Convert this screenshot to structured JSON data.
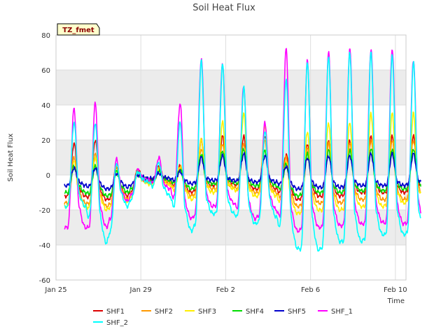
{
  "chart_data": {
    "type": "line",
    "title": "Soil Heat Flux",
    "xlabel": "Time",
    "ylabel": "Soil Heat Flux",
    "tag": "TZ_fmet",
    "xlim": [
      0,
      16.5
    ],
    "ylim": [
      -60,
      80
    ],
    "yticks": [
      -60,
      -40,
      -20,
      0,
      20,
      40,
      60,
      80
    ],
    "xticks": [
      {
        "value": 0,
        "label": "Jan 25"
      },
      {
        "value": 4,
        "label": "Jan 29"
      },
      {
        "value": 8,
        "label": "Feb 2"
      },
      {
        "value": 12,
        "label": "Feb 6"
      },
      {
        "value": 16,
        "label": "Feb 10"
      }
    ],
    "x_range": [
      0.4,
      17.2
    ],
    "band_color": "#ececec",
    "legend_position": "bottom",
    "series": [
      {
        "name": "SHF1",
        "color": "#dd0000",
        "peaks": [
          18,
          20,
          5,
          3,
          5,
          5,
          20,
          22,
          22,
          22,
          12,
          18,
          20,
          20,
          22,
          22,
          22,
          22,
          24
        ],
        "troughs": [
          -12,
          -14,
          -12,
          -3,
          -4,
          -10,
          -6,
          -5,
          -8,
          -8,
          -14,
          -12,
          -12,
          -10,
          -10,
          -10,
          -8,
          -8,
          -8
        ]
      },
      {
        "name": "SHF2",
        "color": "#ff9900",
        "peaks": [
          10,
          12,
          4,
          2,
          4,
          5,
          15,
          18,
          18,
          20,
          10,
          15,
          18,
          18,
          20,
          20,
          20,
          18,
          20
        ],
        "troughs": [
          -16,
          -18,
          -14,
          -4,
          -5,
          -12,
          -8,
          -7,
          -10,
          -10,
          -18,
          -16,
          -16,
          -14,
          -14,
          -14,
          -12,
          -10,
          -10
        ]
      },
      {
        "name": "SHF3",
        "color": "#ffee00",
        "peaks": [
          8,
          10,
          3,
          2,
          3,
          4,
          20,
          30,
          35,
          28,
          8,
          25,
          30,
          30,
          35,
          35,
          35,
          30,
          30
        ],
        "troughs": [
          -18,
          -20,
          -15,
          -5,
          -6,
          -14,
          -10,
          -8,
          -12,
          -12,
          -22,
          -20,
          -20,
          -18,
          -18,
          -16,
          -14,
          -12,
          -12
        ]
      },
      {
        "name": "SHF4",
        "color": "#00dd00",
        "peaks": [
          5,
          5,
          2,
          1,
          2,
          3,
          12,
          14,
          15,
          14,
          6,
          12,
          14,
          14,
          15,
          15,
          15,
          14,
          15
        ],
        "troughs": [
          -10,
          -12,
          -10,
          -3,
          -3,
          -8,
          -5,
          -4,
          -6,
          -6,
          -12,
          -10,
          -10,
          -9,
          -9,
          -8,
          -7,
          -6,
          -6
        ]
      },
      {
        "name": "SHF5",
        "color": "#0000cc",
        "peaks": [
          4,
          4,
          1,
          0,
          1,
          2,
          10,
          11,
          12,
          11,
          5,
          10,
          11,
          11,
          12,
          12,
          12,
          11,
          12
        ],
        "troughs": [
          -6,
          -8,
          -7,
          -2,
          -2,
          -5,
          -3,
          -3,
          -4,
          -4,
          -8,
          -7,
          -7,
          -6,
          -6,
          -6,
          -5,
          -4,
          -4
        ]
      },
      {
        "name": "SHF_1",
        "color": "#ff00ff",
        "peaks": [
          38,
          41,
          9,
          3,
          10,
          41,
          67,
          64,
          51,
          30,
          72,
          65,
          70,
          72,
          72,
          72,
          66,
          65,
          66
        ],
        "troughs": [
          -30,
          -30,
          -15,
          -3,
          -8,
          -25,
          -18,
          -16,
          -25,
          -20,
          -32,
          -30,
          -29,
          -28,
          -27,
          -28,
          -26,
          -20,
          -26
        ]
      },
      {
        "name": "SHF_2",
        "color": "#00ffff",
        "peaks": [
          30,
          30,
          7,
          2,
          7,
          30,
          65,
          63,
          50,
          25,
          55,
          65,
          68,
          70,
          70,
          68,
          64,
          63,
          66
        ],
        "troughs": [
          -18,
          -39,
          -18,
          -4,
          -12,
          -32,
          -22,
          -22,
          -28,
          -24,
          -42,
          -43,
          -38,
          -38,
          -34,
          -34,
          -32,
          -22,
          -29
        ]
      }
    ]
  }
}
